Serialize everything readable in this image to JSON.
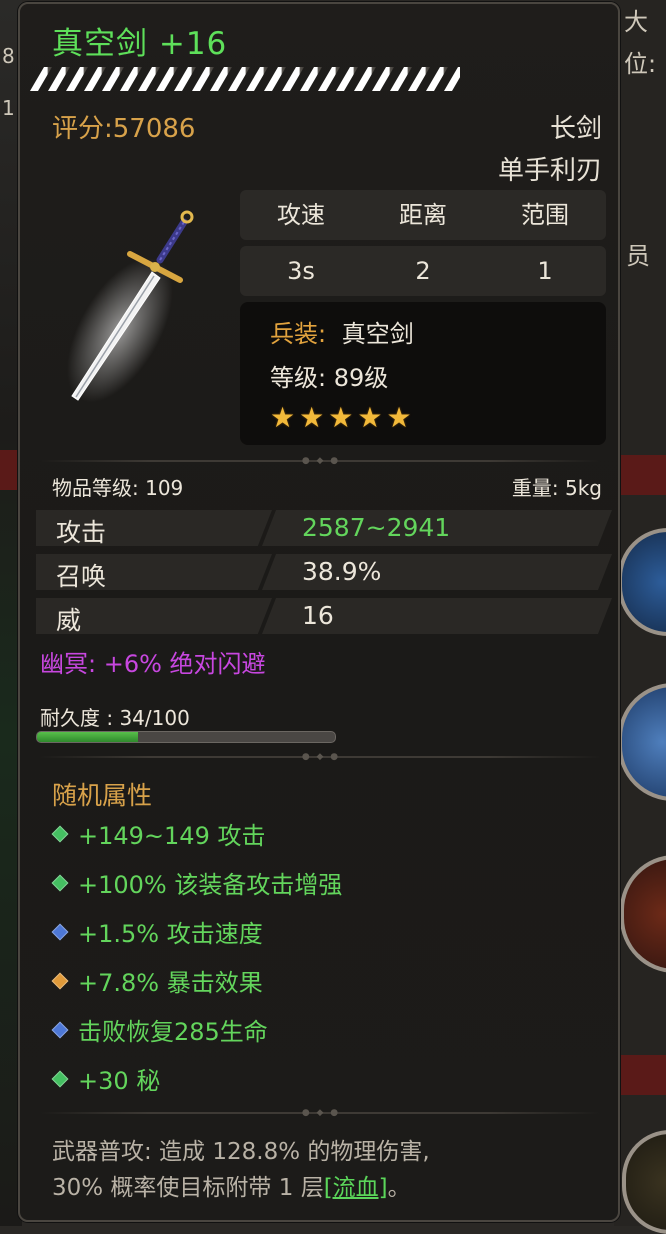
{
  "background": {
    "right_fragments": [
      "大",
      "位:",
      "员"
    ],
    "left_fragments": [
      "8",
      "1"
    ]
  },
  "item": {
    "name": "真空剑 +16",
    "score_label": "评分:57086",
    "weapon_type": "长剑",
    "weapon_class": "单手利刃",
    "stats_headers": [
      "攻速",
      "距离",
      "范围"
    ],
    "stats_values": [
      "3s",
      "2",
      "1"
    ],
    "equip_label": "兵装:",
    "equip_value": "真空剑",
    "level_text": "等级: 89级",
    "stars": 5,
    "item_level": "物品等级: 109",
    "weight": "重量: 5kg",
    "attributes": [
      {
        "name": "攻击",
        "value": "2587~2941",
        "highlight": true
      },
      {
        "name": "召唤",
        "value": "38.9%",
        "highlight": false
      },
      {
        "name": "威",
        "value": "16",
        "highlight": false
      }
    ],
    "special_attr": "幽冥: +6% 绝对闪避",
    "durability_label": "耐久度 : 34/100",
    "durability_fraction": 0.34,
    "random_title": "随机属性",
    "random_attrs": [
      {
        "text": "+149~149 攻击",
        "gem": "green-gem-icon"
      },
      {
        "text": "+100% 该装备攻击增强",
        "gem": "green-gem-icon"
      },
      {
        "text": "+1.5% 攻击速度",
        "gem": "blue-gem-icon"
      },
      {
        "text": "+7.8% 暴击效果",
        "gem": "orange-gem-icon"
      },
      {
        "text": "击败恢复285生命",
        "gem": "blue-gem-icon"
      },
      {
        "text": "+30 秘",
        "gem": "green-gem-icon"
      }
    ],
    "desc_line1": "武器普攻: 造成 128.8% 的物理伤害,",
    "desc_line2_prefix": "30% 概率使目标附带 1 层",
    "desc_link": "[流血]",
    "desc_suffix": "。"
  },
  "colors": {
    "title_green": "#5ee05a",
    "score_orange": "#d8a24a",
    "special_purple": "#c847e0",
    "star_gold": "#f2b93a"
  }
}
